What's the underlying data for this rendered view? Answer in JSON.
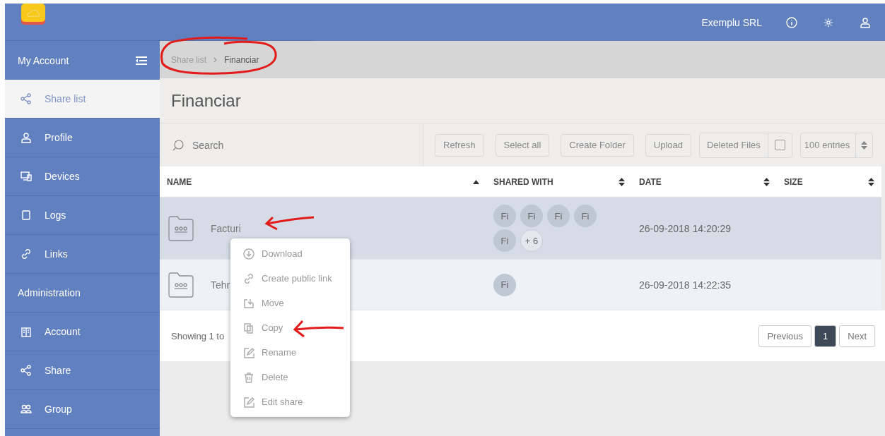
{
  "topbar": {
    "company": "Exemplu SRL"
  },
  "sidebar": {
    "title": "My Account",
    "sections": [
      {
        "items": [
          {
            "label": "Share list",
            "kind": "share",
            "selected": true
          },
          {
            "label": "Profile",
            "kind": "user",
            "selected": false
          },
          {
            "label": "Devices",
            "kind": "devices",
            "selected": false
          },
          {
            "label": "Logs",
            "kind": "square",
            "selected": false
          },
          {
            "label": "Links",
            "kind": "link",
            "selected": false
          }
        ]
      },
      {
        "label": "Administration",
        "items": [
          {
            "label": "Account",
            "kind": "building",
            "selected": false
          },
          {
            "label": "Share",
            "kind": "share",
            "selected": false
          },
          {
            "label": "Group",
            "kind": "group",
            "selected": false
          }
        ]
      }
    ]
  },
  "breadcrumb": [
    {
      "label": "Share list",
      "current": false
    },
    {
      "label": "Financiar",
      "current": true
    }
  ],
  "page_title": "Financiar",
  "search": {
    "placeholder": "Search"
  },
  "toolbar": {
    "buttons": [
      "Refresh",
      "Select all",
      "Create Folder",
      "Upload"
    ],
    "deleted_files": {
      "label": "Deleted Files",
      "checked": false
    },
    "entries": "100 entries"
  },
  "table": {
    "columns": [
      {
        "label": "NAME",
        "sorted": true
      },
      {
        "label": "SHARED WITH",
        "sorted": false
      },
      {
        "label": "DATE",
        "sorted": false
      },
      {
        "label": "SIZE",
        "sorted": false
      }
    ],
    "rows": [
      {
        "name": "Facturi",
        "shared_with": [
          "Fi",
          "Fi",
          "Fi",
          "Fi",
          "Fi"
        ],
        "more": "+ 6",
        "date": "26-09-2018 14:20:29",
        "selected": true
      },
      {
        "name": "Tehr",
        "shared_with": [
          "Fi"
        ],
        "date": "26-09-2018 14:22:35",
        "selected": false
      }
    ]
  },
  "footer": {
    "showing": "Showing 1 to",
    "pagination": [
      {
        "label": "Previous",
        "selected": false
      },
      {
        "label": "1",
        "selected": true
      },
      {
        "label": "Next",
        "selected": false
      }
    ]
  },
  "context_menu": [
    {
      "label": "Download",
      "kind": "download"
    },
    {
      "label": "Create public link",
      "kind": "link"
    },
    {
      "label": "Move",
      "kind": "move"
    },
    {
      "label": "Copy",
      "kind": "copy"
    },
    {
      "label": "Rename",
      "kind": "rename"
    },
    {
      "label": "Delete",
      "kind": "delete"
    },
    {
      "label": "Edit share",
      "kind": "edit"
    }
  ]
}
